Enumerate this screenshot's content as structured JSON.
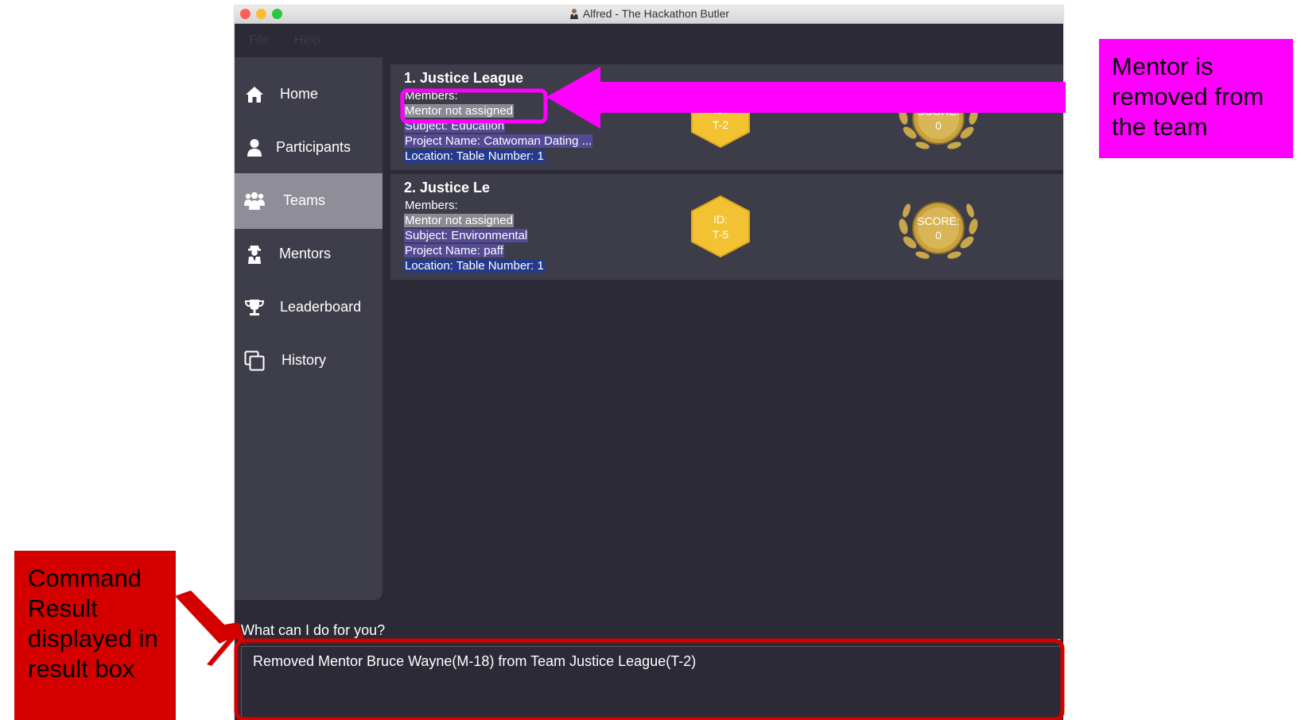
{
  "window": {
    "title": "Alfred - The Hackathon Butler"
  },
  "menu": {
    "file": "File",
    "help": "Help"
  },
  "sidebar": {
    "items": [
      {
        "label": "Home",
        "icon": "home-icon",
        "active": false
      },
      {
        "label": "Participants",
        "icon": "person-icon",
        "active": false
      },
      {
        "label": "Teams",
        "icon": "group-icon",
        "active": true
      },
      {
        "label": "Mentors",
        "icon": "mentor-icon",
        "active": false
      },
      {
        "label": "Leaderboard",
        "icon": "trophy-icon",
        "active": false
      },
      {
        "label": "History",
        "icon": "history-icon",
        "active": false
      }
    ]
  },
  "teams": [
    {
      "title": "1.  Justice League",
      "members": "Members:",
      "mentor": "Mentor not assigned",
      "subject": "Subject: Education",
      "project": "Project Name: Catwoman Dating ...",
      "location": "Location:  Table Number: 1",
      "id_label": "ID:",
      "id_value": "T-2",
      "score_label": "SCORE:",
      "score_value": "0"
    },
    {
      "title": "2.  Justice Le",
      "members": "Members:",
      "mentor": "Mentor not assigned",
      "subject": "Subject: Environmental",
      "project": "Project Name: paff",
      "location": "Location:  Table Number: 1",
      "id_label": "ID:",
      "id_value": "T-5",
      "score_label": "SCORE:",
      "score_value": "0"
    }
  ],
  "command": {
    "prompt": "What can I do for you?",
    "result": "Removed Mentor Bruce Wayne(M-18) from Team Justice League(T-2)"
  },
  "annotations": {
    "mentor_callout": " Mentor is removed from the team",
    "result_callout": "Command Result displayed in result box"
  },
  "colors": {
    "callout_magenta": "#ff00ff",
    "callout_red": "#d40000",
    "app_background": "#2b2a36",
    "sidebar_active": "#8f8e98"
  }
}
